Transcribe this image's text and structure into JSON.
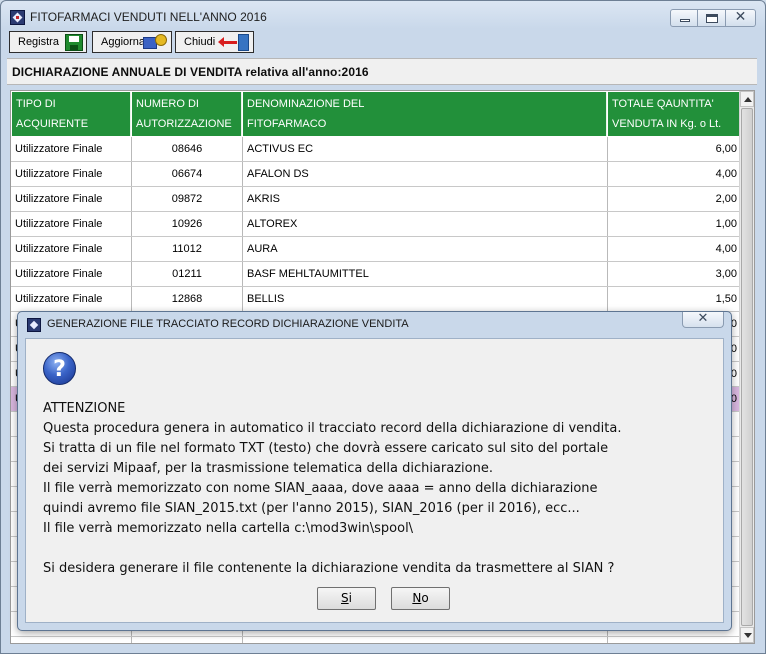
{
  "window": {
    "title": "FITOFARMACI VENDUTI NELL'ANNO 2016",
    "close_glyph": "✕"
  },
  "toolbar": {
    "registra": "Registra",
    "aggiorna": "Aggiorna",
    "chiudi": "Chiudi"
  },
  "header": {
    "title": "DICHIARAZIONE ANNUALE DI VENDITA relativa all'anno:2016"
  },
  "table": {
    "columns": [
      {
        "line1": "TIPO DI",
        "line2": "ACQUIRENTE"
      },
      {
        "line1": "NUMERO DI",
        "line2": "AUTORIZZAZIONE"
      },
      {
        "line1": "DENOMINAZIONE DEL",
        "line2": "FITOFARMACO"
      },
      {
        "line1": "TOTALE QAUNTITA'",
        "line2": "VENDUTA IN Kg. o Lt."
      }
    ],
    "rows": [
      {
        "buyer": "Utilizzatore Finale",
        "auth": "08646",
        "name": "ACTIVUS EC",
        "qty": "6,00"
      },
      {
        "buyer": "Utilizzatore Finale",
        "auth": "06674",
        "name": "AFALON DS",
        "qty": "4,00"
      },
      {
        "buyer": "Utilizzatore Finale",
        "auth": "09872",
        "name": "AKRIS",
        "qty": "2,00"
      },
      {
        "buyer": "Utilizzatore Finale",
        "auth": "10926",
        "name": "ALTOREX",
        "qty": "1,00"
      },
      {
        "buyer": "Utilizzatore Finale",
        "auth": "11012",
        "name": "AURA",
        "qty": "4,00"
      },
      {
        "buyer": "Utilizzatore Finale",
        "auth": "01211",
        "name": "BASF MEHLTAUMITTEL",
        "qty": "3,00"
      },
      {
        "buyer": "Utilizzatore Finale",
        "auth": "12868",
        "name": "BELLIS",
        "qty": "1,50"
      }
    ],
    "partial_rows": [
      {
        "buyer": "U",
        "qty": ",0"
      },
      {
        "buyer": "U",
        "qty": ",0"
      },
      {
        "buyer": "U",
        "qty": ",0"
      },
      {
        "buyer": "U",
        "qty": ",0"
      }
    ]
  },
  "dialog": {
    "title": "GENERAZIONE FILE TRACCIATO RECORD DICHIARAZIONE VENDITA",
    "close_glyph": "✕",
    "icon_glyph": "?",
    "lines": [
      "ATTENZIONE",
      "Questa procedura genera in automatico il tracciato record della dichiarazione di vendita.",
      "Si tratta di un file nel formato TXT (testo) che dovrà essere caricato sul sito del portale",
      "dei servizi Mipaaf, per la trasmissione telematica della dichiarazione.",
      "Il file verrà memorizzato con nome SIAN_aaaa, dove aaaa = anno della dichiarazione",
      "quindi avremo file SIAN_2015.txt (per l'anno 2015), SIAN_2016 (per il 2016), ecc...",
      "Il file verrà memorizzato nella cartella c:\\mod3win\\spool\\"
    ],
    "question": "Si desidera generare il file contenente la dichiarazione vendita da trasmettere al SIAN ?",
    "buttons": {
      "si_mnemonic": "S",
      "si_rest": "i",
      "no_mnemonic": "N",
      "no_rest": "o"
    }
  },
  "colors": {
    "header_green": "#22903a",
    "highlight_row": "#d8b6df",
    "window_chrome": "#c9d8ea"
  }
}
